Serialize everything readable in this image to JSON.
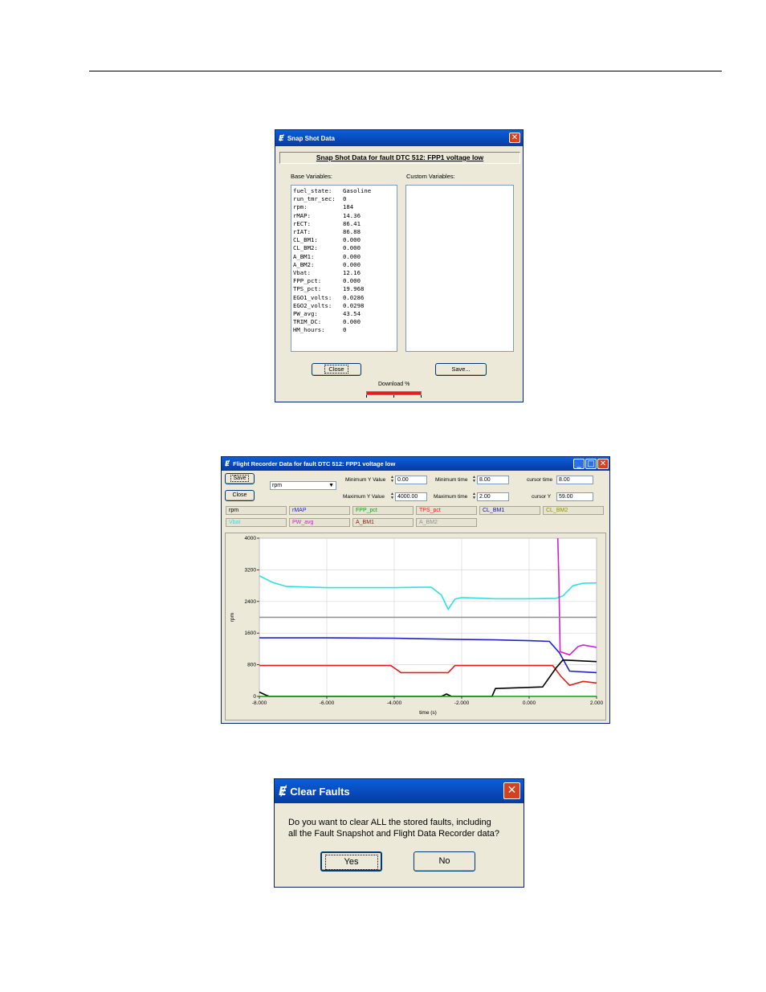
{
  "snapshot": {
    "title": "Snap Shot Data",
    "header": "Snap Shot Data for fault DTC 512: FPP1 voltage low",
    "base_label": "Base Variables:",
    "custom_label": "Custom Variables:",
    "variables": [
      {
        "name": "fuel_state:",
        "value": "Gasoline"
      },
      {
        "name": "run_tmr_sec:",
        "value": "0"
      },
      {
        "name": "rpm:",
        "value": "184"
      },
      {
        "name": "rMAP:",
        "value": "14.36"
      },
      {
        "name": "rECT:",
        "value": "86.41"
      },
      {
        "name": "rIAT:",
        "value": "86.88"
      },
      {
        "name": "CL_BM1:",
        "value": "0.000"
      },
      {
        "name": "CL_BM2:",
        "value": "0.000"
      },
      {
        "name": "A_BM1:",
        "value": "0.000"
      },
      {
        "name": "A_BM2:",
        "value": "0.000"
      },
      {
        "name": "Vbat:",
        "value": "12.16"
      },
      {
        "name": "FPP_pct:",
        "value": "0.000"
      },
      {
        "name": "TPS_pct:",
        "value": "19.968"
      },
      {
        "name": "EGO1_volts:",
        "value": "0.0286"
      },
      {
        "name": "EGO2_volts:",
        "value": "0.0298"
      },
      {
        "name": "PW_avg:",
        "value": "43.54"
      },
      {
        "name": "TRIM_DC:",
        "value": "0.000"
      },
      {
        "name": "HM_hours:",
        "value": "0"
      }
    ],
    "close_label": "Close",
    "save_label": "Save...",
    "download_label": "Download %",
    "download_progress": 1.0,
    "accent": "#e02020"
  },
  "flight": {
    "title": "Flight Recorder Data for fault DTC 512: FPP1 voltage low",
    "save_label": "Save",
    "close_label": "Close",
    "variable_select": "rpm",
    "min_y_label": "Minimum Y Value",
    "min_y_value": "0.00",
    "max_y_label": "Maximum Y Value",
    "max_y_value": "4000.00",
    "min_time_label": "Minimum time",
    "min_time_value": "8.00",
    "max_time_label": "Maximum time",
    "max_time_value": "2.00",
    "cursor_time_label": "cursor time",
    "cursor_time_value": "8.00",
    "cursor_y_label": "cursor Y",
    "cursor_y_value": "59.00",
    "legend": [
      {
        "label": "rpm",
        "color": "#000000"
      },
      {
        "label": "rMAP",
        "color": "#2020d0"
      },
      {
        "label": "FPP_pct",
        "color": "#10a010"
      },
      {
        "label": "TPS_pct",
        "color": "#e02020"
      },
      {
        "label": "CL_BM1",
        "color": "#101090"
      },
      {
        "label": "CL_BM2",
        "color": "#909000"
      },
      {
        "label": "Vbat",
        "color": "#30e0e0"
      },
      {
        "label": "PW_avg",
        "color": "#d020d0"
      },
      {
        "label": "A_BM1",
        "color": "#a01010"
      },
      {
        "label": "A_BM2",
        "color": "#909090"
      }
    ]
  },
  "chart_data": {
    "type": "line",
    "xlabel": "time (s)",
    "ylabel": "rpm",
    "xlim": [
      -8,
      2
    ],
    "ylim": [
      0,
      4000
    ],
    "xticks": [
      "-8.000",
      "-6.000",
      "-4.000",
      "-2.000",
      "0.000",
      "2.000"
    ],
    "yticks": [
      "0",
      "800",
      "1600",
      "2400",
      "3200",
      "4000"
    ],
    "grid": true,
    "series": [
      {
        "name": "Vbat",
        "color": "#30e0e0",
        "x": [
          -8,
          -7.6,
          -7.2,
          -6,
          -4,
          -3.3,
          -2.9,
          -2.6,
          -2.4,
          -2.2,
          -2,
          -1,
          0,
          0.8,
          1.0,
          1.3,
          1.6,
          2
        ],
        "y": [
          3050,
          2880,
          2780,
          2750,
          2750,
          2760,
          2760,
          2560,
          2200,
          2460,
          2500,
          2470,
          2470,
          2480,
          2540,
          2800,
          2860,
          2870
        ]
      },
      {
        "name": "rMAP",
        "color": "#2020d0",
        "x": [
          -8,
          -6,
          -4,
          -2,
          -1,
          0,
          0.6,
          0.9,
          1.2,
          2
        ],
        "y": [
          1480,
          1480,
          1470,
          1440,
          1430,
          1410,
          1390,
          1100,
          640,
          600
        ]
      },
      {
        "name": "TPS_pct",
        "color": "#e02020",
        "x": [
          -8,
          -4.1,
          -3.8,
          -2.4,
          -2.2,
          0.7,
          0.95,
          1.2,
          1.6,
          2
        ],
        "y": [
          780,
          780,
          600,
          600,
          780,
          780,
          500,
          280,
          380,
          340
        ]
      },
      {
        "name": "PW_avg",
        "color": "#d020d0",
        "x": [
          0.85,
          0.88,
          0.92,
          1.2,
          1.45,
          1.6,
          2
        ],
        "y": [
          4000,
          3000,
          1130,
          1050,
          1260,
          1300,
          1240
        ]
      },
      {
        "name": "rpm",
        "color": "#000000",
        "x": [
          -8,
          -7.8,
          -7.7,
          -2.6,
          -2.45,
          -2.3,
          -1.1,
          -1.0,
          -0.3,
          0.4,
          0.8,
          1.0,
          2
        ],
        "y": [
          110,
          30,
          0,
          0,
          60,
          0,
          0,
          200,
          220,
          240,
          720,
          920,
          880
        ]
      },
      {
        "name": "FPP_pct",
        "color": "#10a010",
        "x": [
          -8,
          2
        ],
        "y": [
          0,
          0
        ]
      },
      {
        "name": "A_BM2",
        "color": "#909090",
        "x": [
          -8,
          2
        ],
        "y": [
          2000,
          2000
        ]
      }
    ]
  },
  "clear": {
    "title": "Clear Faults",
    "message_line1": "Do you want to clear ALL the stored faults, including",
    "message_line2": "all the Fault Snapshot and Flight Data Recorder data?",
    "yes_label": "Yes",
    "no_label": "No"
  }
}
